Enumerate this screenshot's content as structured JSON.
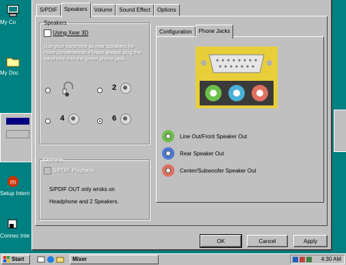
{
  "desktop": {
    "icons": [
      {
        "label": "My Co",
        "color": "#ffffcc"
      },
      {
        "label": "My Doc",
        "color": "#ffffa0"
      },
      {
        "label": "Setup Intern",
        "color": "#cc3300"
      },
      {
        "label": "Connec Inte",
        "color": "#ffffff"
      }
    ]
  },
  "tabs": [
    "S/PDIF",
    "Speakers",
    "Volume",
    "Sound Effect",
    "Options"
  ],
  "speakers_group": {
    "legend": "Speakers",
    "xear_label": "Using Xear 3D",
    "disabled_text": "Use your earphone as rear speakers for more convenience. Please always plug the earphone into the green phone jack.",
    "options": [
      {
        "label": "",
        "selected": false
      },
      {
        "label": "2",
        "selected": false
      },
      {
        "label": "4",
        "selected": false
      },
      {
        "label": "6",
        "selected": true
      }
    ]
  },
  "options_group": {
    "legend": "Options",
    "spdif_playback": "S/PDIF Playback",
    "note_line1": "S/PDIF OUT only wroks on",
    "note_line2": "Headphone and 2 Speakers."
  },
  "right_tabs": [
    "Configuration",
    "Phone Jacks"
  ],
  "jacks": [
    {
      "label": "Line Out/Front Speaker Out",
      "color": "#6cc04a"
    },
    {
      "label": "Rear Speaker Out",
      "color": "#4a78d6"
    },
    {
      "label": "Center/Subwoofer Speaker Out",
      "color": "#e07060"
    }
  ],
  "buttons": {
    "ok": "OK",
    "cancel": "Cancel",
    "apply": "Apply"
  },
  "taskbar": {
    "start": "Start",
    "app": "Mixer",
    "time": "4:30 AM"
  }
}
